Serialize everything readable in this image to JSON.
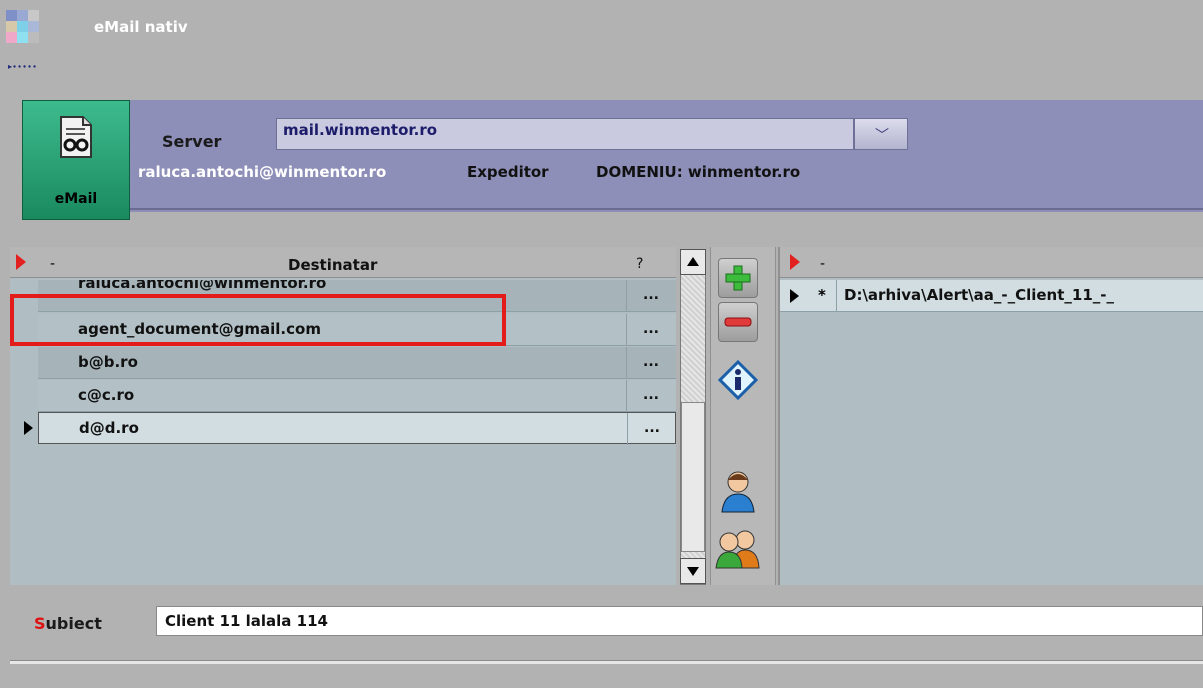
{
  "window": {
    "title": "eMail nativ"
  },
  "email_button": {
    "label": "eMail"
  },
  "server": {
    "label": "Server",
    "value": "mail.winmentor.ro"
  },
  "sender": {
    "user": "raluca.antochi@winmentor.ro",
    "role": "Expeditor",
    "domain": "DOMENIU: winmentor.ro"
  },
  "recipients": {
    "header": {
      "col0": "-",
      "col1": "Destinatar",
      "col2": "?"
    },
    "rows": [
      {
        "email": "raluca.antochi@winmentor.ro",
        "action": "..."
      },
      {
        "email": "agent_document@gmail.com",
        "action": "..."
      },
      {
        "email": "b@b.ro",
        "action": "..."
      },
      {
        "email": "c@c.ro",
        "action": "..."
      },
      {
        "email": "d@d.ro",
        "action": "..."
      }
    ]
  },
  "attachments": {
    "header": {
      "col0": "-"
    },
    "rows": [
      {
        "marker": "*",
        "path": "D:\\arhiva\\Alert\\aa_-_Client_11_-_"
      }
    ]
  },
  "subject": {
    "label_first": "S",
    "label_rest": "ubiect",
    "value": "Client 11 lalala  114"
  },
  "icons": [
    "app-logo-icon",
    "document-icon",
    "plus-icon",
    "minus-icon",
    "info-icon",
    "user-icon",
    "users-icon"
  ],
  "colors": {
    "header_band": "#8e8fb9",
    "email_button": "#2aa876",
    "grid": "#b0bec4",
    "highlight_box": "#e41b1b"
  }
}
